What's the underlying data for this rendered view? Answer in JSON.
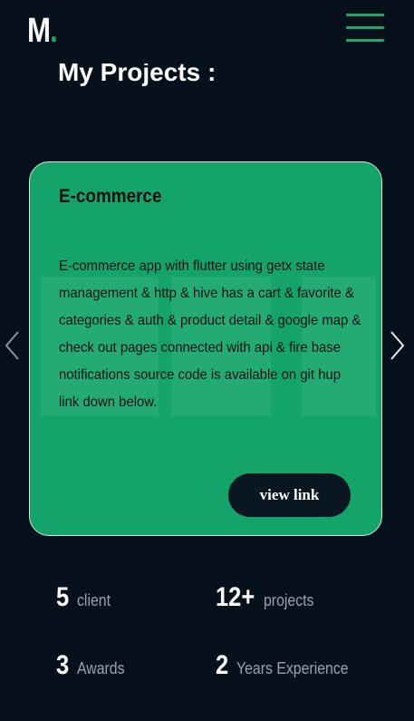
{
  "header": {
    "logo_letter": "M",
    "logo_dot": ".",
    "accent_color": "#1aaa6c",
    "menu_icon": "hamburger-menu-icon"
  },
  "section": {
    "title": "My Projects :"
  },
  "slider": {
    "prev_icon": "chevron-left-icon",
    "next_icon": "chevron-right-icon"
  },
  "project": {
    "title": "E-commerce",
    "description": "E-commerce app with flutter using getx state management & http & hive has a cart & favorite & categories & auth & product detail & google map & check out pages connected with api & fire base notifications source code is available on git hup link down below.",
    "link_label": "view link",
    "card_color": "#14a469"
  },
  "stats": [
    {
      "number": "5",
      "label": "client"
    },
    {
      "number": "12+",
      "label": "projects"
    },
    {
      "number": "3",
      "label": "Awards"
    },
    {
      "number": "2",
      "label": "Years Experience"
    }
  ]
}
